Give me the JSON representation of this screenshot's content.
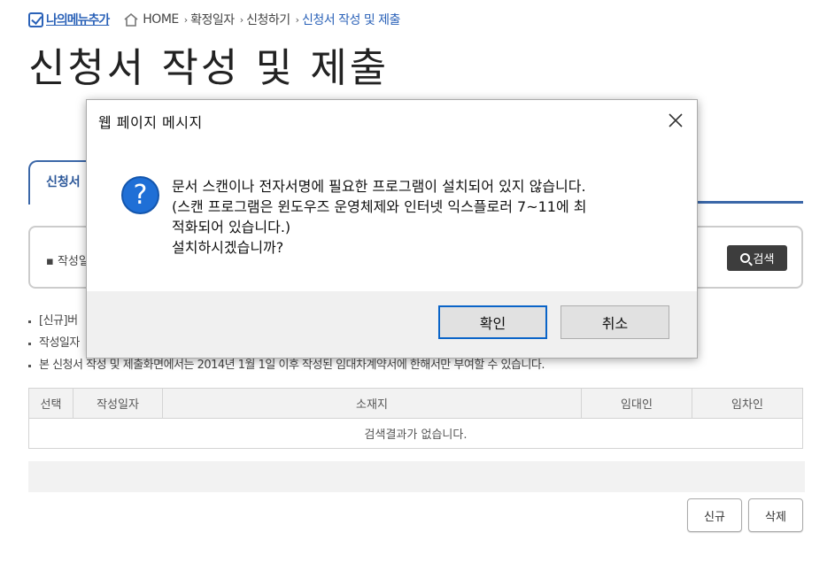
{
  "breadcrumb": {
    "my_menu": "나의메뉴추가",
    "items": [
      "HOME",
      "확정일자",
      "신청하기",
      "신청서 작성 및 제출"
    ]
  },
  "page": {
    "title": "신청서 작성 및 제출"
  },
  "tab": {
    "label": "신청서"
  },
  "search": {
    "label": "작성일",
    "button": "검색"
  },
  "notes": [
    "[신규]버",
    "작성일자",
    "본 신청서 작성 및 제출화면에서는 2014년 1월 1일 이후 작성된 임대차계약서에 한해서만 부여할 수 있습니다."
  ],
  "table": {
    "headers": [
      "선택",
      "작성일자",
      "소재지",
      "임대인",
      "임차인"
    ],
    "empty_message": "검색결과가 없습니다."
  },
  "actions": {
    "new": "신규",
    "delete": "삭제"
  },
  "dialog": {
    "title": "웹 페이지 메시지",
    "icon": "question-icon",
    "lines": [
      "문서 스캔이나 전자서명에 필요한 프로그램이 설치되어 있지 않습니다.",
      "(스캔 프로그램은 윈도우즈 운영체제와 인터넷 익스플로러 7~11에 최",
      "적화되어 있습니다.)",
      "설치하시겠습니까?"
    ],
    "ok": "확인",
    "cancel": "취소"
  },
  "colors": {
    "accent": "#2b62b8",
    "tab_border": "#3b67a8",
    "dialog_icon": "#1f6fd6"
  }
}
